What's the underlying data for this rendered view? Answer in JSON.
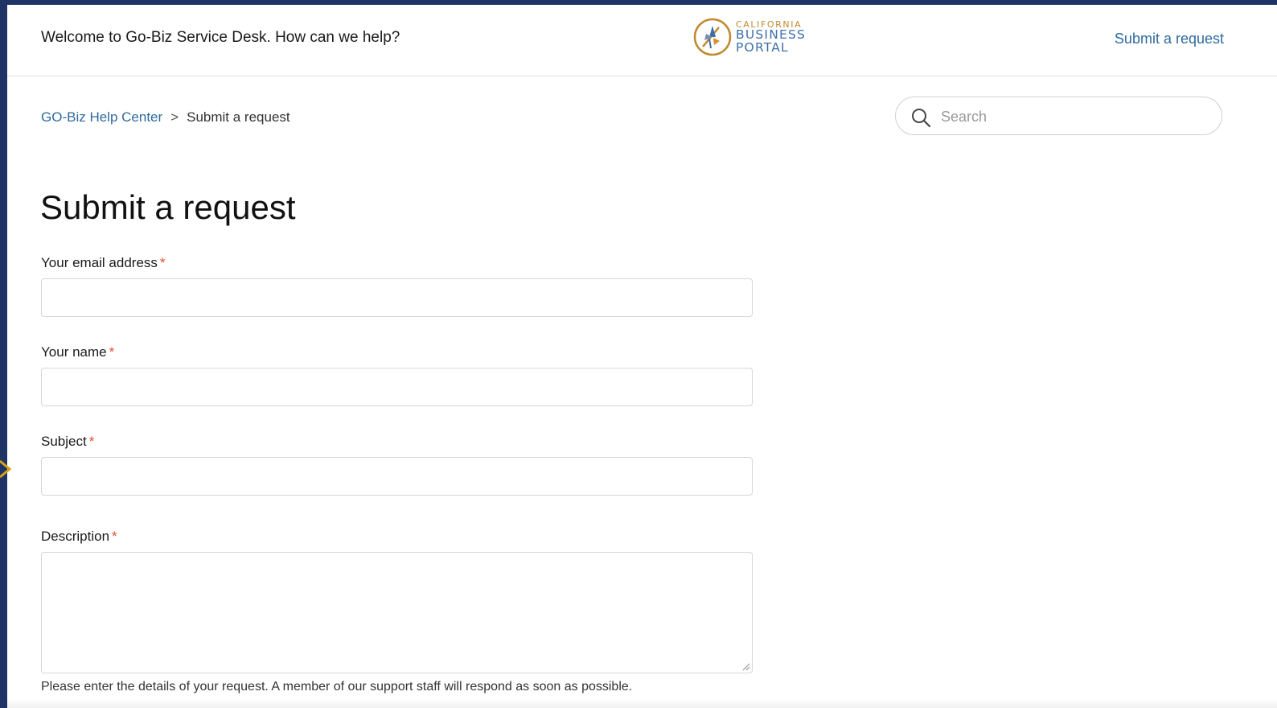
{
  "header": {
    "welcome_text": "Welcome to Go-Biz Service Desk. How can we help?",
    "logo": {
      "line1": "CALIFORNIA",
      "line2": "BUSINESS",
      "line3": "PORTAL",
      "icon": "california-poppy-emblem-icon"
    },
    "submit_request_link": "Submit a request"
  },
  "breadcrumb": {
    "home": "GO-Biz Help Center",
    "separator": ">",
    "current": "Submit a request"
  },
  "search": {
    "placeholder": "Search",
    "value": "",
    "icon": "search-icon"
  },
  "page_title": "Submit a request",
  "form": {
    "required_marker": "*",
    "fields": [
      {
        "label": "Your email address",
        "value": ""
      },
      {
        "label": "Your name",
        "value": ""
      },
      {
        "label": "Subject",
        "value": ""
      },
      {
        "label": "Description",
        "value": ""
      }
    ],
    "description_hint": "Please enter the details of your request. A member of our support staff will respond as soon as possible."
  },
  "colors": {
    "frame_border": "#1f3464",
    "link": "#2f6a9e",
    "required": "#e34f32",
    "logo_gold": "#c08a2e",
    "logo_blue": "#3e6ea9"
  }
}
